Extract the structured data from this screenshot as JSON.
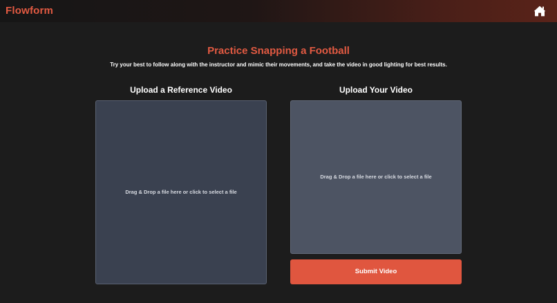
{
  "header": {
    "brand": "Flowform",
    "home_icon": "home-icon"
  },
  "main": {
    "title": "Practice Snapping a Football",
    "subtitle": "Try your best to follow along with the instructor and mimic their movements, and take the video in good lighting for best results."
  },
  "reference_upload": {
    "heading": "Upload a Reference Video",
    "dropzone_text": "Drag & Drop a file here or click to select a file"
  },
  "user_upload": {
    "heading": "Upload Your Video",
    "dropzone_text": "Drag & Drop a file here or click to select a file",
    "submit_label": "Submit Video"
  },
  "colors": {
    "accent": "#e0563f",
    "background": "#1c1c1c",
    "reference_dropzone": "#3a4150",
    "user_dropzone": "#4d5463"
  }
}
